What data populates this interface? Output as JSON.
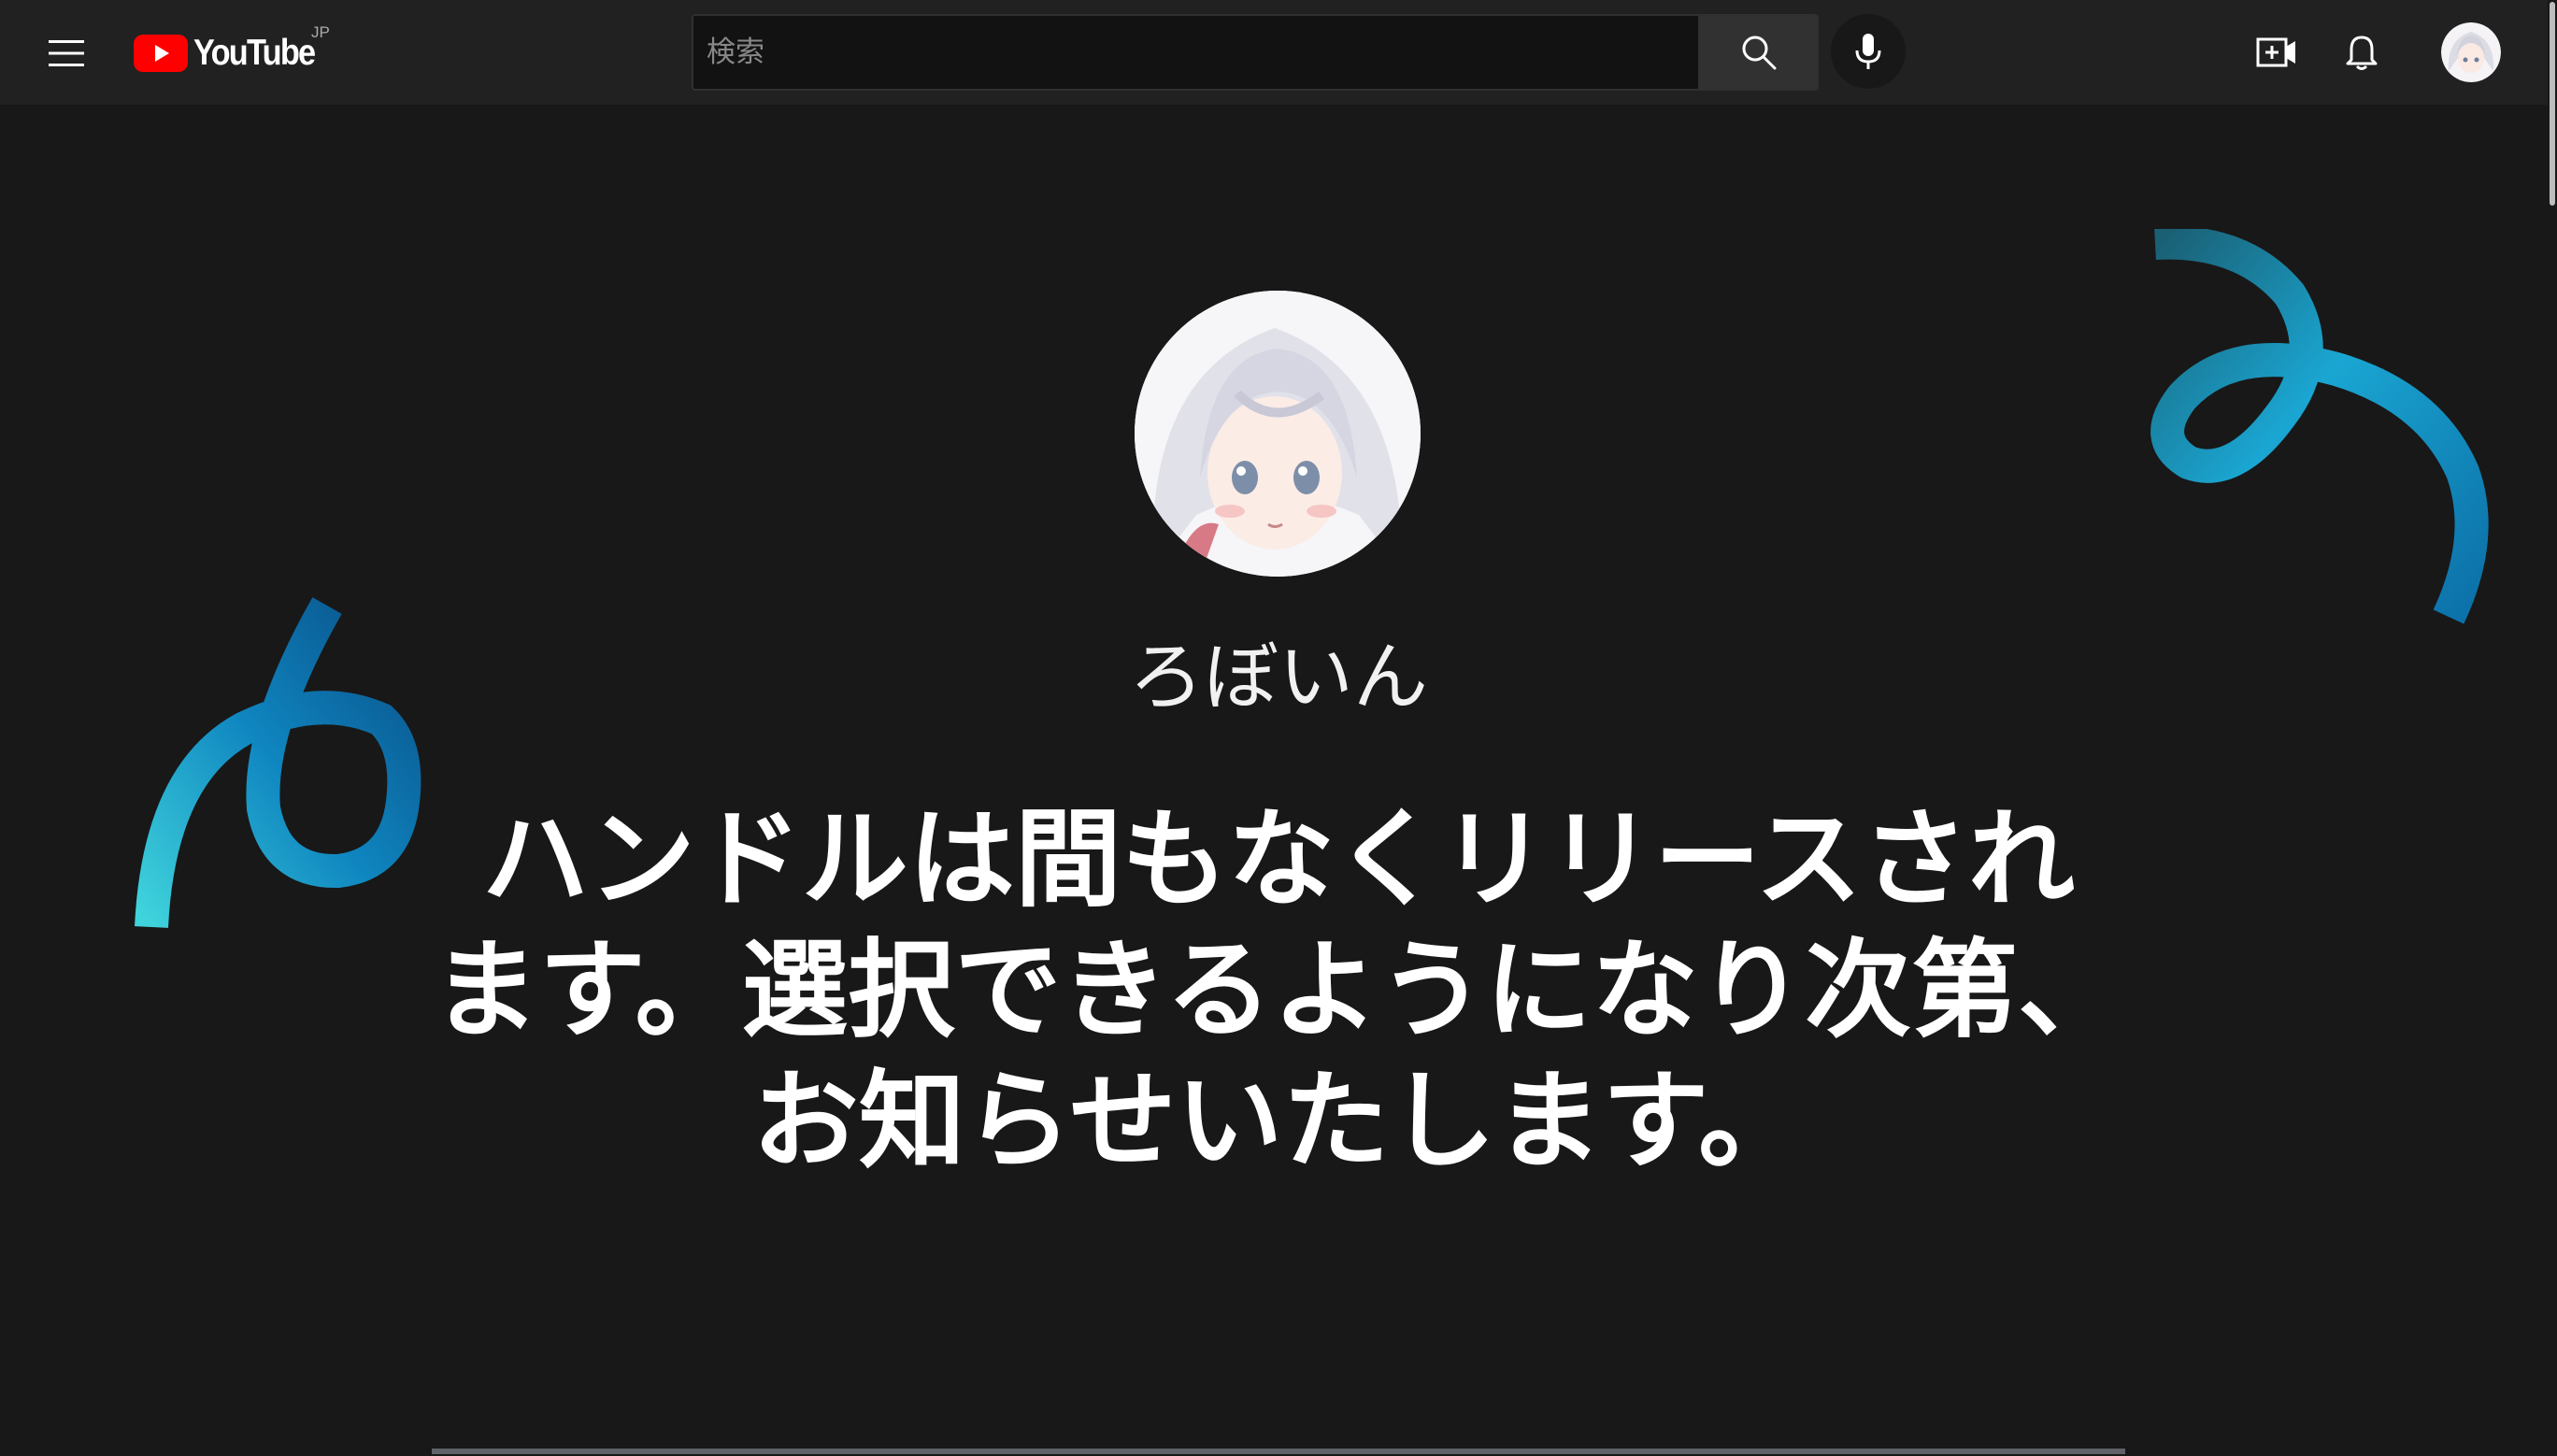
{
  "header": {
    "menu_icon": "hamburger-menu-icon",
    "logo_text": "YouTube",
    "logo_region": "JP",
    "logo_color": "#ff0000",
    "search": {
      "placeholder": "検索",
      "value": ""
    },
    "search_icon": "search-icon",
    "mic_icon": "microphone-icon",
    "create_icon": "create-video-icon",
    "notifications_icon": "bell-icon",
    "account_icon": "avatar"
  },
  "main": {
    "channel_name": "ろぼいん",
    "message": "ハンドルは間もなくリリースされます。選択できるようになり次第、お知らせいたします。"
  },
  "colors": {
    "background": "#181818",
    "topbar": "#212121",
    "accent_cyan": "#39c8d8",
    "accent_blue": "#0a6ea8"
  }
}
